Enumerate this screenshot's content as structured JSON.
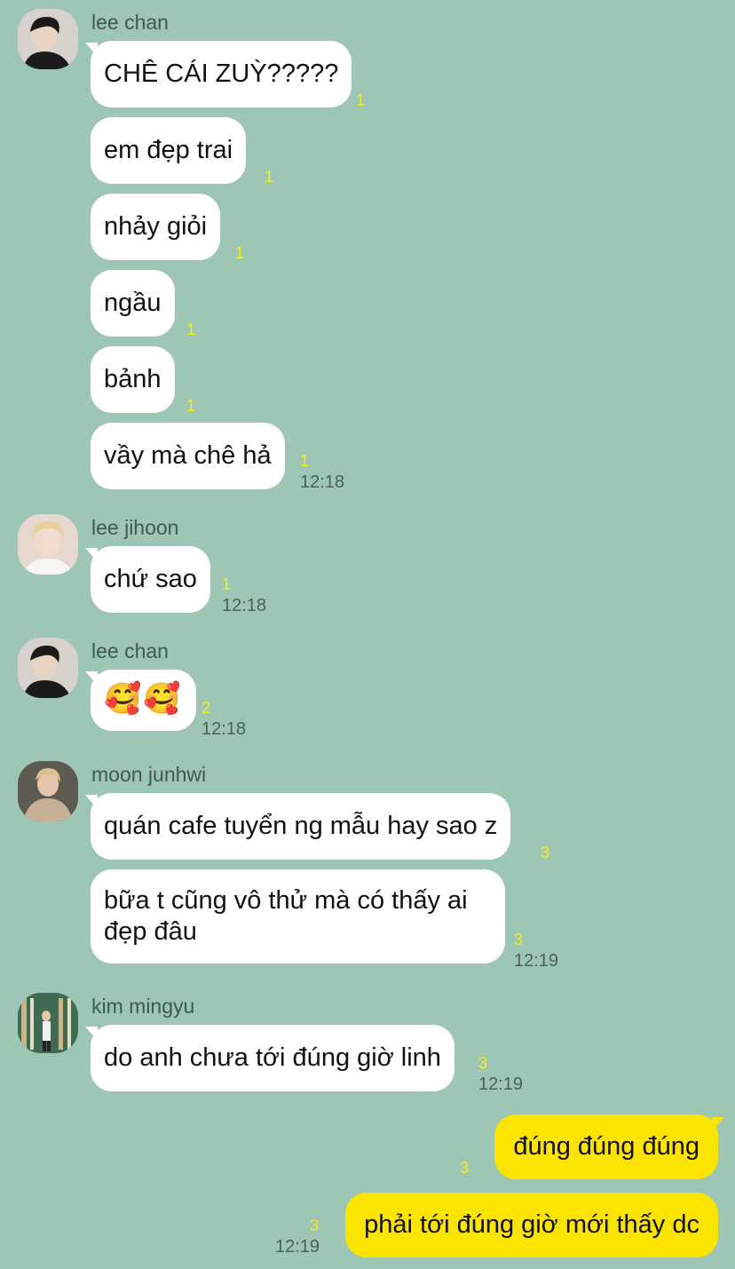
{
  "messages": [
    {
      "sender": "lee chan",
      "avatar": "lee-chan-avatar",
      "bubbles": [
        {
          "text": "CHÊ CÁI ZUỲ?????",
          "unread": "1"
        },
        {
          "text": "em đẹp trai",
          "unread": "1"
        },
        {
          "text": "nhảy giỏi",
          "unread": "1"
        },
        {
          "text": "ngầu",
          "unread": "1"
        },
        {
          "text": "bảnh",
          "unread": "1"
        },
        {
          "text": "vầy mà chê hả",
          "unread": "1",
          "time": "12:18"
        }
      ]
    },
    {
      "sender": "lee jihoon",
      "avatar": "lee-jihoon-avatar",
      "bubbles": [
        {
          "text": "chứ sao",
          "unread": "1",
          "time": "12:18"
        }
      ]
    },
    {
      "sender": "lee chan",
      "avatar": "lee-chan-avatar",
      "bubbles": [
        {
          "text": "🥰🥰",
          "unread": "2",
          "time": "12:18"
        }
      ]
    },
    {
      "sender": "moon junhwi",
      "avatar": "moon-junhwi-avatar",
      "bubbles": [
        {
          "text": "quán cafe tuyển ng mẫu hay sao z",
          "unread": "3"
        },
        {
          "text": "bữa t cũng vô thử mà có thấy ai đẹp đâu",
          "unread": "3",
          "time": "12:19"
        }
      ]
    },
    {
      "sender": "kim mingyu",
      "avatar": "kim-mingyu-avatar",
      "bubbles": [
        {
          "text": "do anh chưa tới đúng giờ linh",
          "unread": "3",
          "time": "12:19"
        }
      ]
    }
  ],
  "my_messages": [
    {
      "text": "đúng đúng đúng",
      "unread": "3"
    },
    {
      "text": "phải tới đúng giờ mới thấy dc",
      "unread": "3",
      "time": "12:19"
    }
  ],
  "colors": {
    "background": "#9dc6b4",
    "incoming_bubble": "#ffffff",
    "outgoing_bubble": "#fbe400",
    "unread_count": "#f6ef1a"
  }
}
